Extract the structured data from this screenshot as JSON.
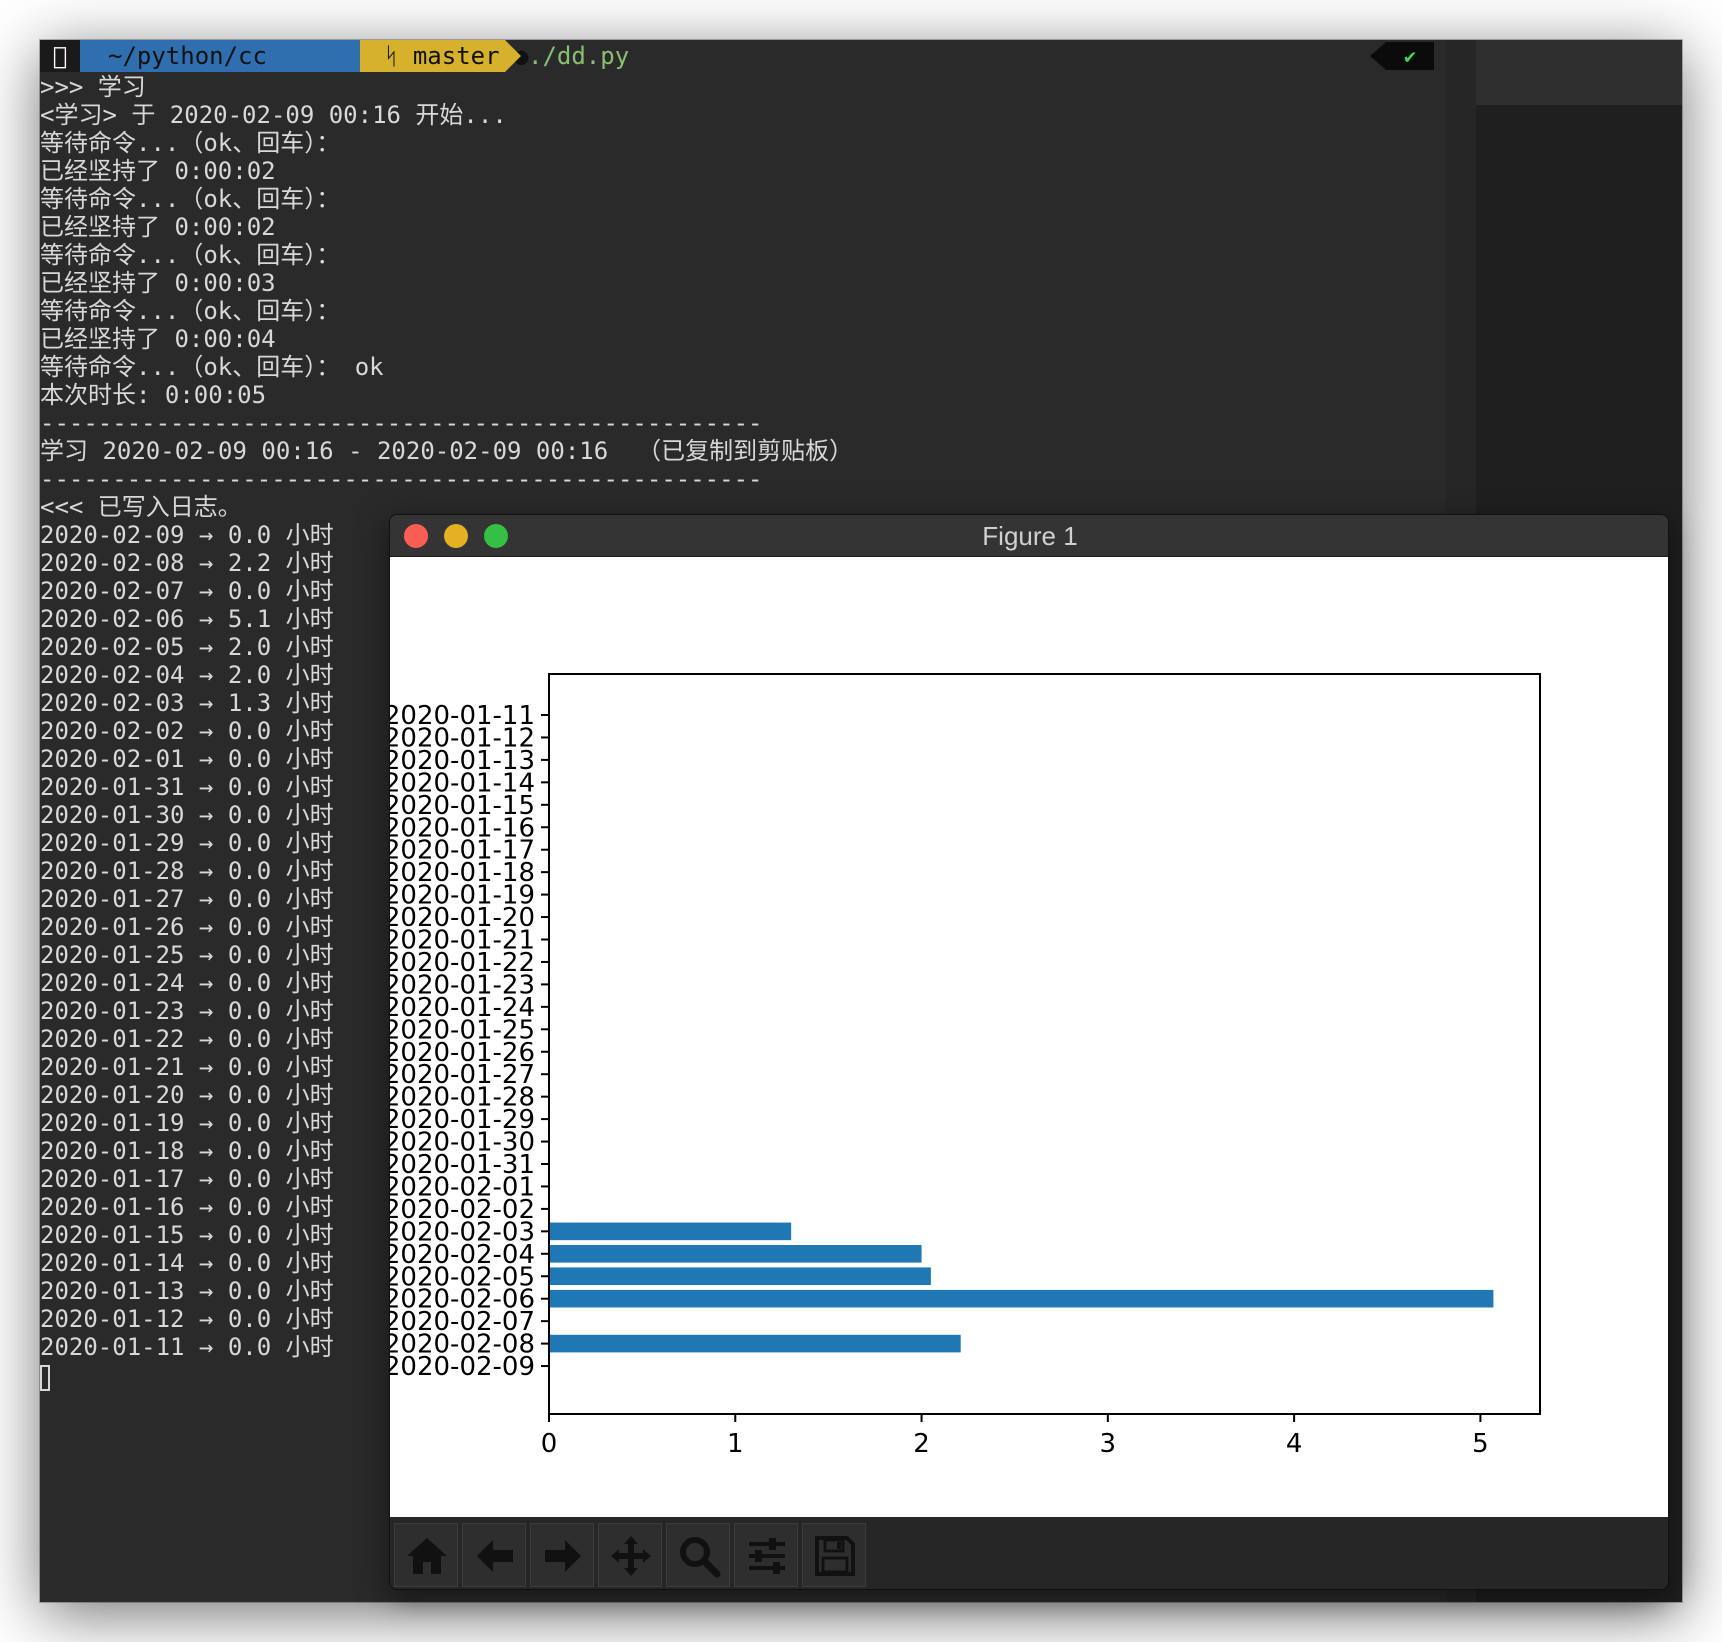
{
  "prompt": {
    "apple": "",
    "path": "~/python/cc",
    "branch": "ᛋ master ●",
    "command": "./dd.py",
    "status": "✔"
  },
  "terminal": {
    "lines": [
      ">>> 学习",
      "<学习> 于 2020-02-09 00:16 开始...",
      "等待命令...（ok、回车）：",
      "已经坚持了 0:00:02",
      "等待命令...（ok、回车）：",
      "已经坚持了 0:00:02",
      "等待命令...（ok、回车）：",
      "已经坚持了 0:00:03",
      "等待命令...（ok、回车）：",
      "已经坚持了 0:00:04",
      "等待命令...（ok、回车）： ok",
      "本次时长: 0:00:05",
      "--------------------------------------------------",
      "学习 2020-02-09 00:16 - 2020-02-09 00:16  （已复制到剪贴板）",
      "--------------------------------------------------",
      "<<< 已写入日志。",
      "2020-02-09 → 0.0 小时",
      "2020-02-08 → 2.2 小时",
      "2020-02-07 → 0.0 小时",
      "2020-02-06 → 5.1 小时",
      "2020-02-05 → 2.0 小时",
      "2020-02-04 → 2.0 小时",
      "2020-02-03 → 1.3 小时",
      "2020-02-02 → 0.0 小时",
      "2020-02-01 → 0.0 小时",
      "2020-01-31 → 0.0 小时",
      "2020-01-30 → 0.0 小时",
      "2020-01-29 → 0.0 小时",
      "2020-01-28 → 0.0 小时",
      "2020-01-27 → 0.0 小时",
      "2020-01-26 → 0.0 小时",
      "2020-01-25 → 0.0 小时",
      "2020-01-24 → 0.0 小时",
      "2020-01-23 → 0.0 小时",
      "2020-01-22 → 0.0 小时",
      "2020-01-21 → 0.0 小时",
      "2020-01-20 → 0.0 小时",
      "2020-01-19 → 0.0 小时",
      "2020-01-18 → 0.0 小时",
      "2020-01-17 → 0.0 小时",
      "2020-01-16 → 0.0 小时",
      "2020-01-15 → 0.0 小时",
      "2020-01-14 → 0.0 小时",
      "2020-01-13 → 0.0 小时",
      "2020-01-12 → 0.0 小时",
      "2020-01-11 → 0.0 小时"
    ]
  },
  "figure": {
    "title": "Figure 1",
    "toolbar": [
      {
        "name": "home-button",
        "icon": "home-icon"
      },
      {
        "name": "back-button",
        "icon": "arrow-left-icon"
      },
      {
        "name": "forward-button",
        "icon": "arrow-right-icon"
      },
      {
        "name": "pan-button",
        "icon": "move-icon"
      },
      {
        "name": "zoom-button",
        "icon": "magnifier-icon"
      },
      {
        "name": "configure-subplots-button",
        "icon": "sliders-icon"
      },
      {
        "name": "save-button",
        "icon": "floppy-disk-icon"
      }
    ]
  },
  "chart_data": {
    "type": "bar",
    "orientation": "horizontal",
    "categories": [
      "2020-02-09",
      "2020-02-08",
      "2020-02-07",
      "2020-02-06",
      "2020-02-05",
      "2020-02-04",
      "2020-02-03",
      "2020-02-02",
      "2020-02-01",
      "2020-01-31",
      "2020-01-30",
      "2020-01-29",
      "2020-01-28",
      "2020-01-27",
      "2020-01-26",
      "2020-01-25",
      "2020-01-24",
      "2020-01-23",
      "2020-01-22",
      "2020-01-21",
      "2020-01-20",
      "2020-01-19",
      "2020-01-18",
      "2020-01-17",
      "2020-01-16",
      "2020-01-15",
      "2020-01-14",
      "2020-01-13",
      "2020-01-12",
      "2020-01-11"
    ],
    "values": [
      0.0,
      2.21,
      0.0,
      5.07,
      2.05,
      2.0,
      1.3,
      0.0,
      0.0,
      0.0,
      0.0,
      0.0,
      0.0,
      0.0,
      0.0,
      0.0,
      0.0,
      0.0,
      0.0,
      0.0,
      0.0,
      0.0,
      0.0,
      0.0,
      0.0,
      0.0,
      0.0,
      0.0,
      0.0,
      0.0
    ],
    "xlim": [
      0,
      5.32
    ],
    "xticks": [
      0,
      1,
      2,
      3,
      4,
      5
    ],
    "bar_color": "#1f77b4",
    "title": "",
    "xlabel": "",
    "ylabel": "",
    "grid": false
  }
}
